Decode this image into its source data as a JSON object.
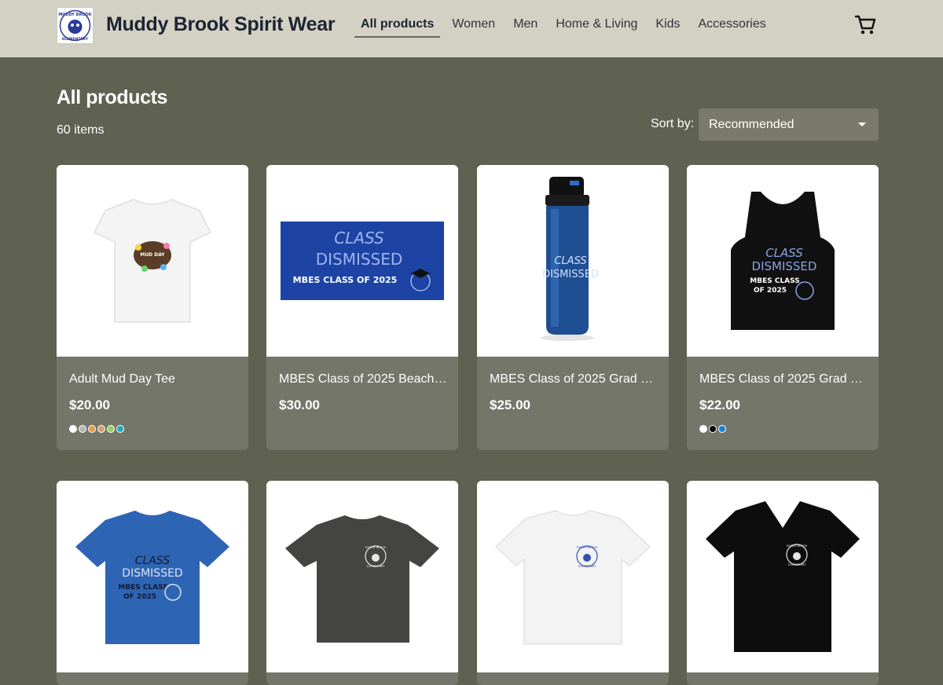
{
  "header": {
    "store_name": "Muddy Brook Spirit Wear",
    "logo_text": "MUDDY BROOK ELEMENTARY",
    "nav": [
      "All products",
      "Women",
      "Men",
      "Home & Living",
      "Kids",
      "Accessories"
    ],
    "active_nav": "All products",
    "cart_icon": "cart-icon"
  },
  "main": {
    "title": "All products",
    "item_count": "60 items",
    "sort_label": "Sort by:",
    "sort_value": "Recommended"
  },
  "products": [
    {
      "name": "Adult Mud Day Tee",
      "price": "$20.00",
      "colors": [
        "#ffffff",
        "#b4b4b4",
        "#e39b4d",
        "#d1a06a",
        "#9acd6b",
        "#23a8b8"
      ],
      "image": "white-tshirt"
    },
    {
      "name": "MBES Class of 2025 Beach T...",
      "price": "$30.00",
      "colors": [],
      "image": "blue-towel"
    },
    {
      "name": "MBES Class of 2025 Grad W...",
      "price": "$25.00",
      "colors": [],
      "image": "blue-bottle"
    },
    {
      "name": "MBES Class of 2025 Grad Ta...",
      "price": "$22.00",
      "colors": [
        "#ffffff",
        "#000000",
        "#1e7fd0"
      ],
      "image": "black-tank"
    },
    {
      "name": "",
      "price": "",
      "colors": [],
      "image": "royal-blue-tshirt"
    },
    {
      "name": "",
      "price": "",
      "colors": [],
      "image": "charcoal-tshirt"
    },
    {
      "name": "",
      "price": "",
      "colors": [],
      "image": "white-tshirt"
    },
    {
      "name": "",
      "price": "",
      "colors": [],
      "image": "black-vneck"
    }
  ],
  "image_text": {
    "mud_day": "MUD DAY",
    "class": "CLASS",
    "dismissed": "DISMISSED",
    "class_year": "MBES CLASS OF 2025",
    "class_year_short": "MBES CLASS",
    "year": "OF 2025",
    "school_line1": "MUDDY BROOK",
    "school_line2": "ELEMENTARY"
  }
}
